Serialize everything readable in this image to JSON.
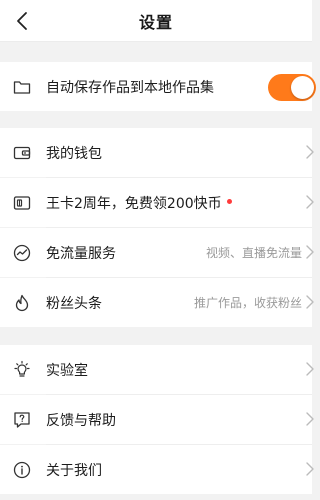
{
  "header": {
    "title": "设置"
  },
  "colors": {
    "accent": "#ff7a1a",
    "badge": "#ff3b3b"
  },
  "settings": {
    "auto_save": {
      "label": "自动保存作品到本地作品集",
      "enabled": true
    }
  },
  "account": {
    "wallet": {
      "label": "我的钱包"
    },
    "promo": {
      "label": "王卡2周年，免费领200快币"
    },
    "free_data": {
      "label": "免流量服务",
      "sub": "视频、直播免流量"
    },
    "fans": {
      "label": "粉丝头条",
      "sub": "推广作品，收获粉丝"
    }
  },
  "more": {
    "lab": {
      "label": "实验室"
    },
    "feedback": {
      "label": "反馈与帮助"
    },
    "about": {
      "label": "关于我们"
    }
  }
}
